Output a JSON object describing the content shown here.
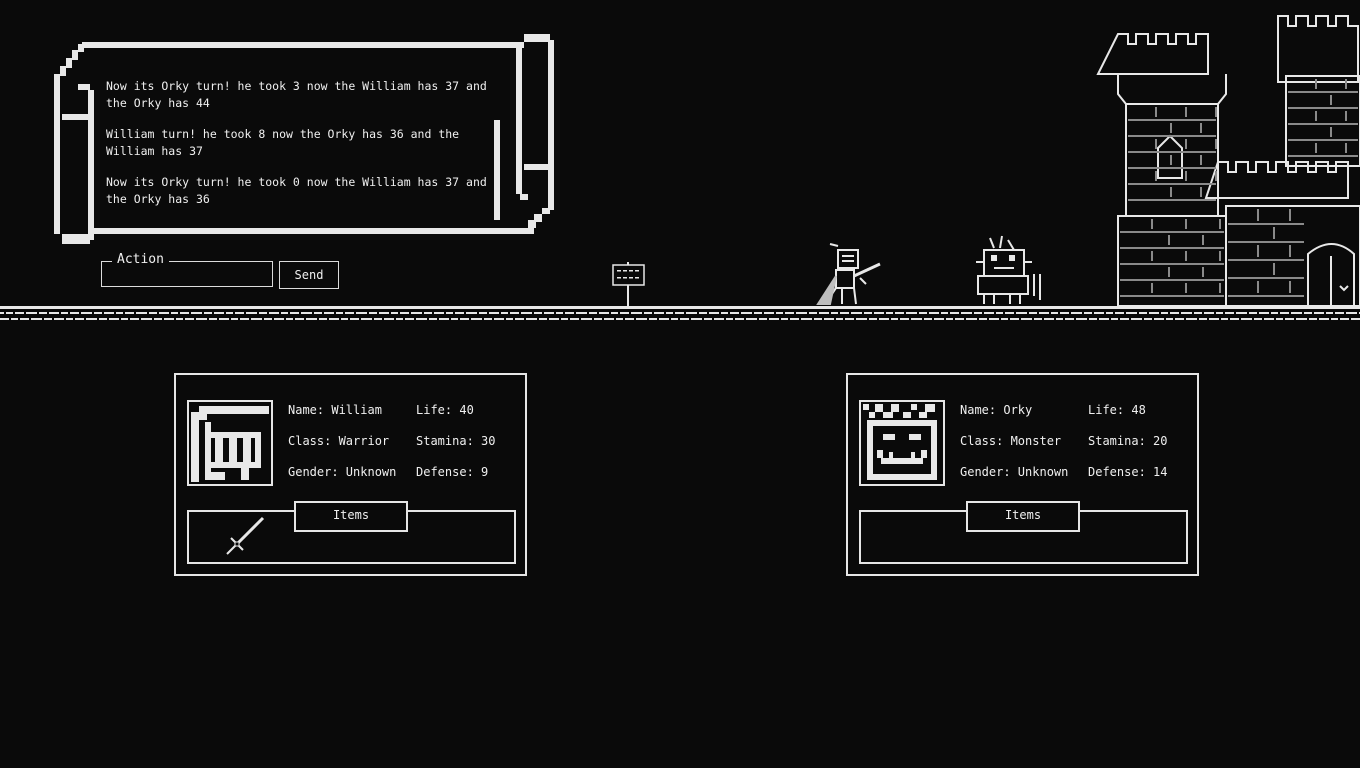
{
  "log": {
    "entries": [
      "Now its Orky turn! he took 3 now the William has 37 and the Orky has 44",
      "William turn! he took 8 now the Orky has 36 and the William has 37",
      "Now its Orky turn! he took 0 now the William has 37 and the Orky has 36"
    ]
  },
  "action": {
    "legend": "Action",
    "value": "",
    "placeholder": "",
    "send_label": "Send"
  },
  "player": {
    "name": "Name: William",
    "class": "Class: Warrior",
    "gender": "Gender: Unknown",
    "life": "Life: 40",
    "stamina": "Stamina: 30",
    "defense": "Defense: 9",
    "items_label": "Items",
    "items": [
      "sword-icon"
    ]
  },
  "enemy": {
    "name": "Name: Orky",
    "class": "Class: Monster",
    "gender": "Gender: Unknown",
    "life": "Life: 48",
    "stamina": "Stamina: 20",
    "defense": "Defense: 14",
    "items_label": "Items",
    "items": []
  },
  "colors": {
    "background": "#0a0a0a",
    "foreground": "#e8e8e8",
    "brick_gray": "#777777"
  }
}
